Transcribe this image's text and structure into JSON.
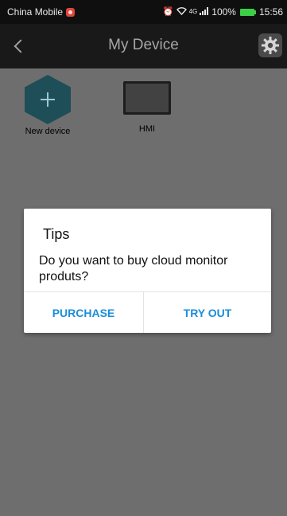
{
  "status_bar": {
    "carrier": "China Mobile",
    "network": "4G",
    "battery": "100%",
    "time": "15:56",
    "icons": [
      "alarm-icon",
      "wifi-icon",
      "signal-icon",
      "battery-icon"
    ]
  },
  "app_bar": {
    "title": "My Device"
  },
  "devices": [
    {
      "label": "New device",
      "icon": "add-device-icon"
    },
    {
      "label": "HMI",
      "icon": "hmi-screen-icon"
    }
  ],
  "dialog": {
    "title": "Tips",
    "message": "Do you want to buy cloud monitor produts?",
    "buttons": {
      "purchase": "PURCHASE",
      "try_out": "TRY OUT"
    }
  },
  "colors": {
    "accent": "#1a8ed9",
    "app_bar": "#191919",
    "backdrop": "#6e6e6e",
    "battery": "#3ccf47"
  }
}
